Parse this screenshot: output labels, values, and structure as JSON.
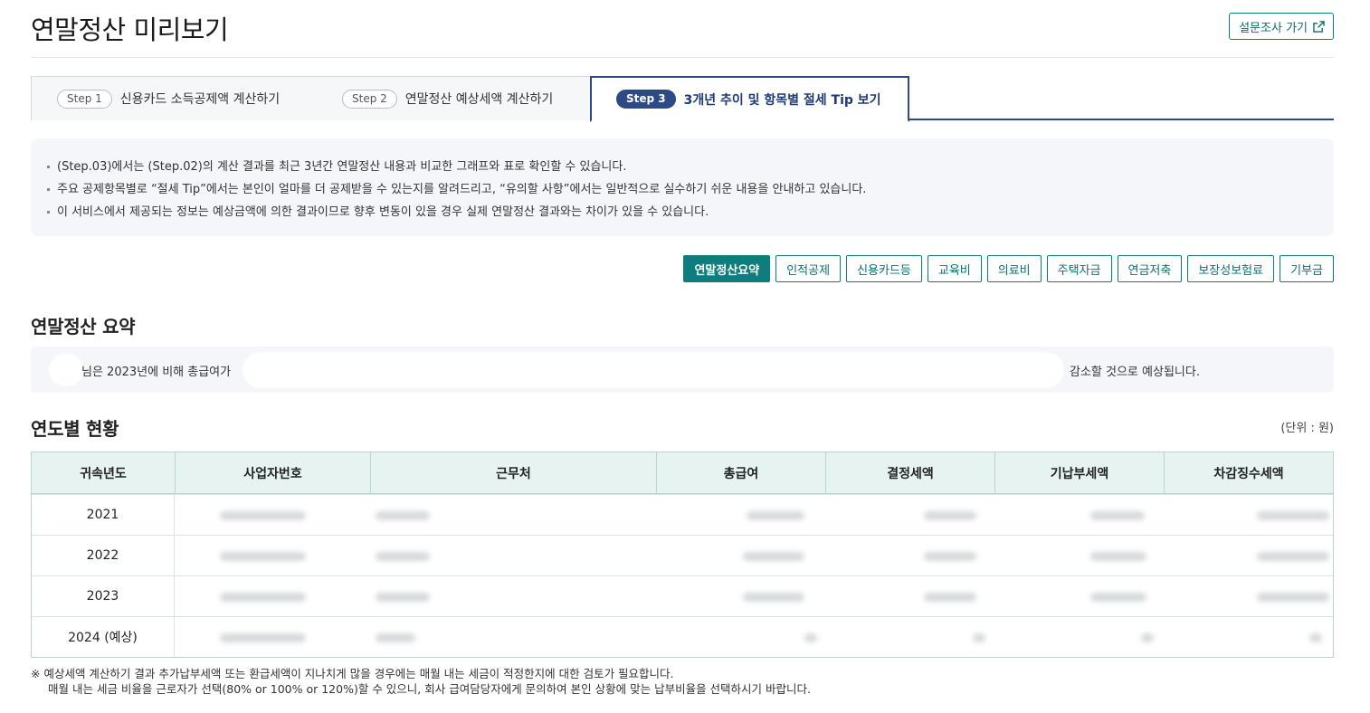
{
  "header": {
    "title": "연말정산 미리보기",
    "survey_label": "설문조사 가기"
  },
  "tabs": [
    {
      "step": "Step 1",
      "label": "신용카드 소득공제액 계산하기"
    },
    {
      "step": "Step 2",
      "label": "연말정산 예상세액 계산하기"
    },
    {
      "step": "Step 3",
      "label": "3개년 추이 및 항목별 절세 Tip 보기"
    }
  ],
  "info": [
    "(Step.03)에서는 (Step.02)의 계산 결과를 최근 3년간 연말정산 내용과 비교한 그래프와 표로 확인할 수 있습니다.",
    "주요 공제항목별로 “절세 Tip”에서는 본인이 얼마를 더 공제받을 수 있는지를 알려드리고, “유의할 사항”에서는 일반적으로 실수하기 쉬운 내용을 안내하고 있습니다.",
    "이 서비스에서 제공되는 정보는 예상금액에 의한 결과이므로 향후 변동이 있을 경우 실제 연말정산 결과와는 차이가 있을 수 있습니다."
  ],
  "categories": [
    "연말정산요약",
    "인적공제",
    "신용카드등",
    "교육비",
    "의료비",
    "주택자금",
    "연금저축",
    "보장성보험료",
    "기부금"
  ],
  "summary": {
    "title": "연말정산 요약",
    "text_part1": "님은 2023년에 비해 총급여가",
    "text_part2": "감소할 것으로 예상됩니다."
  },
  "yearly": {
    "title": "연도별 현황",
    "unit": "(단위 : 원)",
    "columns": [
      "귀속년도",
      "사업자번호",
      "근무처",
      "총급여",
      "결정세액",
      "기납부세액",
      "차감징수세액"
    ],
    "rows": [
      "2021",
      "2022",
      "2023",
      "2024  (예상)"
    ]
  },
  "notes": {
    "line1": "※ 예상세액 계산하기 결과 추가납부세액 또는 환급세액이 지나치게 많을 경우에는 매월 내는 세금이 적정한지에 대한 검토가 필요합니다.",
    "line2": "매월 내는 세금 비율을 근로자가 선택(80% or 100% or 120%)할 수 있으니, 회사 급여담당자에게 문의하여 본인 상황에 맞는 납부비율을 선택하시기 바랍니다."
  },
  "colors": {
    "accent": "#0f7d7e",
    "tab_active": "#2d4a86",
    "table_header": "#e6f3f1"
  }
}
